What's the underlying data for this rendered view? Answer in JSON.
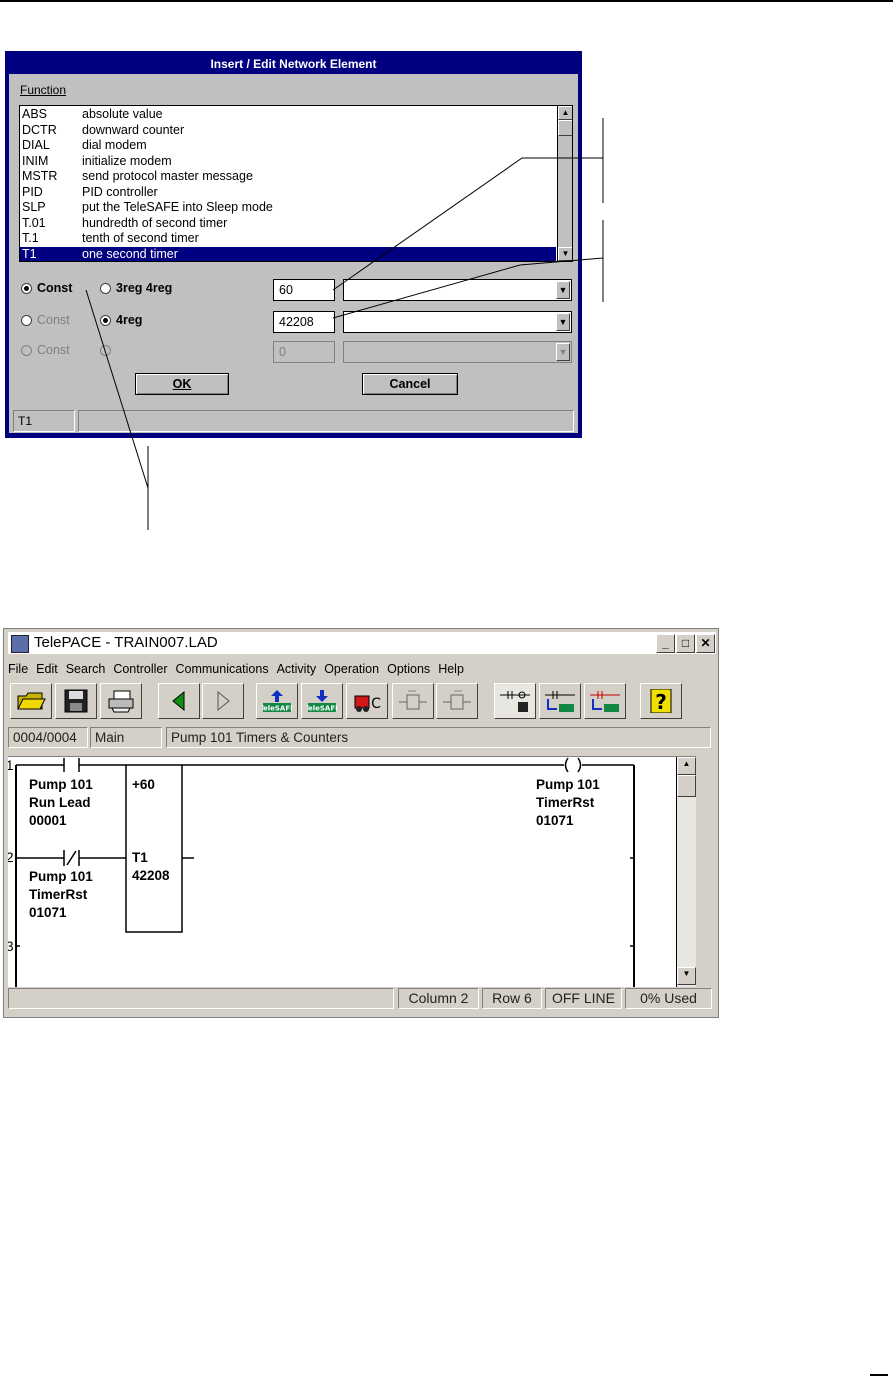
{
  "dialog": {
    "title": "Insert / Edit Network Element",
    "function_label": "Function",
    "functions": [
      {
        "code": "ABS",
        "desc": "absolute value"
      },
      {
        "code": "DCTR",
        "desc": "downward counter"
      },
      {
        "code": "DIAL",
        "desc": "dial modem"
      },
      {
        "code": "INIM",
        "desc": "initialize modem"
      },
      {
        "code": "MSTR",
        "desc": "send protocol master message"
      },
      {
        "code": "PID",
        "desc": "PID controller"
      },
      {
        "code": "SLP",
        "desc": "put the TeleSAFE into Sleep mode"
      },
      {
        "code": "T.01",
        "desc": "hundredth of second timer"
      },
      {
        "code": "T.1",
        "desc": "tenth of second timer"
      },
      {
        "code": "T1",
        "desc": "one second timer"
      }
    ],
    "row1": {
      "const_label": "Const",
      "reg_label": "3reg 4reg",
      "value": "60"
    },
    "row2": {
      "const_label": "Const",
      "reg_label": "4reg",
      "value": "42208"
    },
    "row3": {
      "const_label": "Const",
      "reg_label": "",
      "value": "0"
    },
    "ok_label": "OK",
    "cancel_label": "Cancel",
    "status_left": "T1",
    "status_right": ""
  },
  "app": {
    "title": "TelePACE - TRAIN007.LAD",
    "menu": [
      "File",
      "Edit",
      "Search",
      "Controller",
      "Communications",
      "Activity",
      "Operation",
      "Options",
      "Help"
    ],
    "toolbar_icons": [
      "open-folder-icon",
      "save-disk-icon",
      "print-icon",
      "back-arrow-icon",
      "forward-arrow-icon",
      "upload-telesafe-icon",
      "download-telesafe-icon",
      "compile-c-icon",
      "insert-left-icon",
      "insert-right-icon",
      "ladder-save-icon",
      "ladder-read-icon",
      "ladder-write-icon",
      "help-icon"
    ],
    "toolbar_text": {
      "telesafe": "TeleSAFE",
      "c_letter": "C",
      "help": "?"
    },
    "network": "0004/0004",
    "section": "Main",
    "network_title": "Pump 101 Timers & Counters",
    "rungs": [
      "1",
      "2",
      "3"
    ],
    "contact1": {
      "line1": "Pump 101",
      "line2": "Run Lead",
      "line3": "00001"
    },
    "contact2": {
      "line1": "Pump 101",
      "line2": "TimerRst",
      "line3": "01071"
    },
    "block": {
      "top": "+60",
      "name": "T1",
      "reg": "42208"
    },
    "coil": {
      "line1": "Pump 101",
      "line2": "TimerRst",
      "line3": "01071"
    },
    "status": {
      "col": "Column 2",
      "row": "Row 6",
      "mode": "OFF LINE",
      "used": "0% Used"
    }
  }
}
